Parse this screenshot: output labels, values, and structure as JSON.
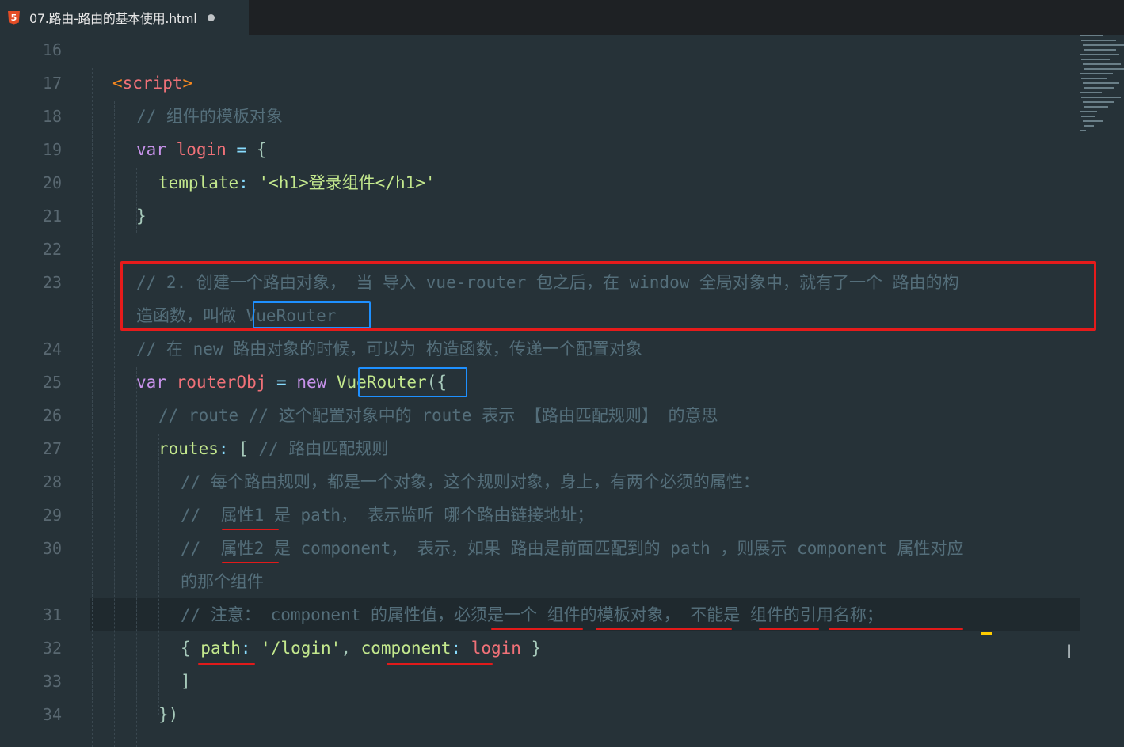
{
  "window": {
    "tab": {
      "title": "07.路由-路由的基本使用.html",
      "icon": "html5-icon"
    }
  },
  "editor": {
    "active_line": 31,
    "lines": [
      {
        "num": "16",
        "segments": []
      },
      {
        "num": "17",
        "segments": [
          {
            "t": "<",
            "c": "c-tag"
          },
          {
            "t": "script",
            "c": "c-tagname"
          },
          {
            "t": ">",
            "c": "c-tag"
          }
        ]
      },
      {
        "num": "18",
        "segments": [
          {
            "t": "// 组件的模板对象",
            "c": "c-comment"
          }
        ]
      },
      {
        "num": "19",
        "segments": [
          {
            "t": "var ",
            "c": "c-keyword"
          },
          {
            "t": "login",
            "c": "c-var"
          },
          {
            "t": " = ",
            "c": "c-op"
          },
          {
            "t": "{",
            "c": "c-punc"
          }
        ]
      },
      {
        "num": "20",
        "segments": [
          {
            "t": "template",
            "c": "c-prop"
          },
          {
            "t": ": ",
            "c": "c-op"
          },
          {
            "t": "'<h1>登录组件</h1>'",
            "c": "c-string"
          }
        ]
      },
      {
        "num": "21",
        "segments": [
          {
            "t": "}",
            "c": "c-punc"
          }
        ]
      },
      {
        "num": "22",
        "segments": []
      },
      {
        "num": "23",
        "segments": [
          {
            "t": "// 2. 创建一个路由对象， 当 导入 vue-router 包之后，在 window 全局对象中，就有了一个 路由的构",
            "c": "c-comment"
          }
        ]
      },
      {
        "num": "",
        "segments": [
          {
            "t": "造函数，叫做 VueRouter",
            "c": "c-comment"
          }
        ]
      },
      {
        "num": "24",
        "segments": [
          {
            "t": "// 在 new 路由对象的时候，可以为 构造函数，传递一个配置对象",
            "c": "c-comment"
          }
        ]
      },
      {
        "num": "25",
        "segments": [
          {
            "t": "var ",
            "c": "c-keyword"
          },
          {
            "t": "routerObj",
            "c": "c-var"
          },
          {
            "t": " = ",
            "c": "c-op"
          },
          {
            "t": "new ",
            "c": "c-keyword"
          },
          {
            "t": "VueRouter",
            "c": "c-prop"
          },
          {
            "t": "({",
            "c": "c-punc"
          }
        ]
      },
      {
        "num": "26",
        "segments": [
          {
            "t": "// route // 这个配置对象中的 route 表示 【路由匹配规则】 的意思",
            "c": "c-comment"
          }
        ]
      },
      {
        "num": "27",
        "segments": [
          {
            "t": "routes",
            "c": "c-prop"
          },
          {
            "t": ": ",
            "c": "c-op"
          },
          {
            "t": "[ ",
            "c": "c-punc"
          },
          {
            "t": "// 路由匹配规则",
            "c": "c-comment"
          }
        ]
      },
      {
        "num": "28",
        "segments": [
          {
            "t": "// 每个路由规则，都是一个对象，这个规则对象，身上，有两个必须的属性：",
            "c": "c-comment"
          }
        ]
      },
      {
        "num": "29",
        "segments": [
          {
            "t": "//  属性1 是 path， 表示监听 哪个路由链接地址；",
            "c": "c-comment"
          }
        ]
      },
      {
        "num": "30",
        "segments": [
          {
            "t": "//  属性2 是 component， 表示，如果 路由是前面匹配到的 path ，则展示 component 属性对应",
            "c": "c-comment"
          }
        ]
      },
      {
        "num": "",
        "segments": [
          {
            "t": "的那个组件",
            "c": "c-comment"
          }
        ]
      },
      {
        "num": "31",
        "segments": [
          {
            "t": "// 注意： component 的属性值，必须是一个 组件的模板对象， 不能是 组件的引用名称；",
            "c": "c-comment"
          }
        ]
      },
      {
        "num": "32",
        "segments": [
          {
            "t": "{ ",
            "c": "c-punc"
          },
          {
            "t": "path",
            "c": "c-prop"
          },
          {
            "t": ": ",
            "c": "c-op"
          },
          {
            "t": "'/login'",
            "c": "c-string"
          },
          {
            "t": ", ",
            "c": "c-punc"
          },
          {
            "t": "component",
            "c": "c-prop"
          },
          {
            "t": ": ",
            "c": "c-op"
          },
          {
            "t": "login",
            "c": "c-var"
          },
          {
            "t": " }",
            "c": "c-punc"
          }
        ]
      },
      {
        "num": "33",
        "segments": [
          {
            "t": "]",
            "c": "c-punc"
          }
        ]
      },
      {
        "num": "34",
        "segments": [
          {
            "t": "})",
            "c": "c-punc"
          }
        ]
      }
    ]
  },
  "colors": {
    "background": "#263238",
    "tabbar": "#1e2124",
    "annotation_red": "#e61b1b",
    "annotation_blue": "#1e90ff",
    "caret": "#ffcc00"
  }
}
